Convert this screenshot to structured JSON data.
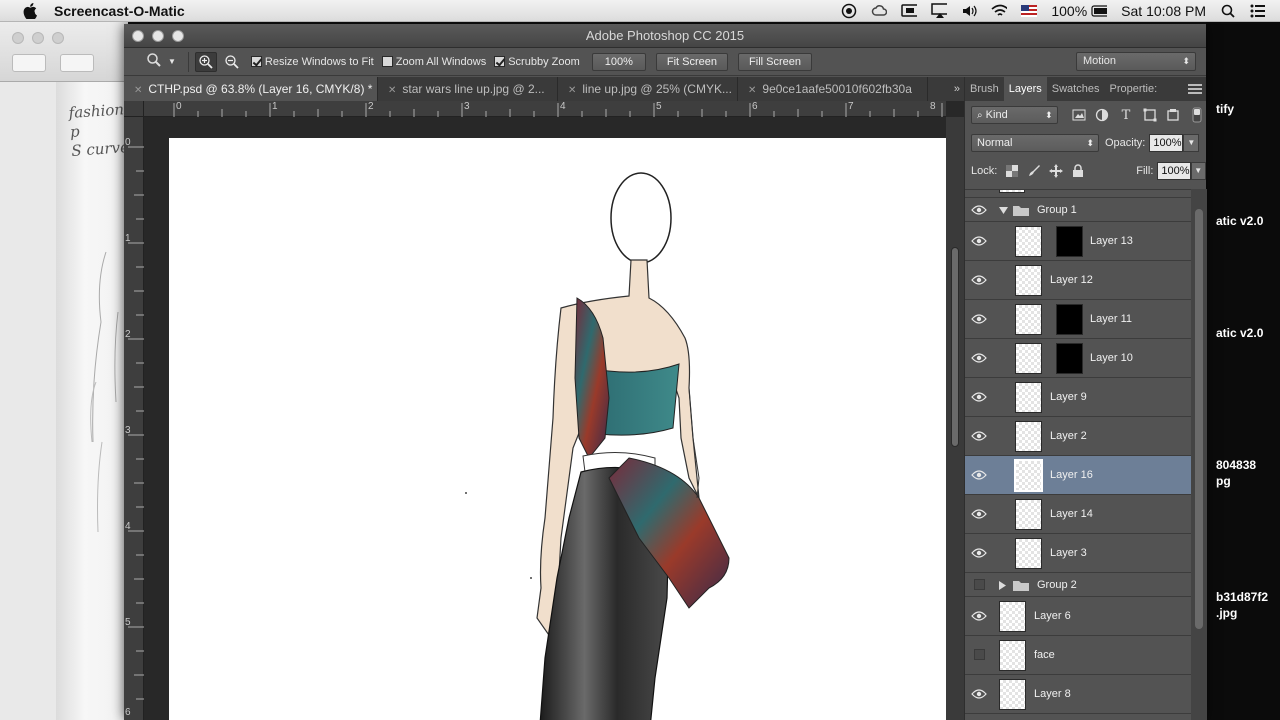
{
  "menubar": {
    "app_name": "Screencast-O-Matic",
    "battery": "100%",
    "clock": "Sat 10:08 PM"
  },
  "background_left": {
    "paper_text_1": "fashion p",
    "paper_text_2": "S curve"
  },
  "background_right": {
    "labels": [
      "tify",
      "atic v2.0",
      "atic v2.0",
      "804838",
      "pg",
      "b31d87f2",
      ".jpg"
    ]
  },
  "window": {
    "title": "Adobe Photoshop CC 2015"
  },
  "options": {
    "resize_windows": "Resize Windows to Fit",
    "zoom_all": "Zoom All Windows",
    "scrubby": "Scrubby Zoom",
    "zoom_value": "100%",
    "fit_screen": "Fit Screen",
    "fill_screen": "Fill Screen",
    "workspace": "Motion"
  },
  "doc_tabs": [
    "CTHP.psd @ 63.8% (Layer 16, CMYK/8) *",
    "star wars line up.jpg @ 2...",
    "line up.jpg @ 25% (CMYK...",
    "9e0ce1aafe50010f602fb30a"
  ],
  "tabs_more": "»",
  "rulers": {
    "h": [
      "0",
      "1",
      "2",
      "3",
      "4",
      "5",
      "6",
      "7",
      "8"
    ],
    "v": [
      "0",
      "1",
      "2",
      "3",
      "4",
      "5",
      "6"
    ]
  },
  "panel_tabs": [
    "Brush",
    "Layers",
    "Swatches",
    "Propertie:"
  ],
  "layers_panel": {
    "filter_kind": "Kind",
    "blend_mode": "Normal",
    "opacity_label": "Opacity:",
    "opacity_value": "100%",
    "lock_label": "Lock:",
    "fill_label": "Fill:",
    "fill_value": "100%"
  },
  "layers": [
    {
      "name": "Group 1",
      "type": "group",
      "expanded": true,
      "visible": true
    },
    {
      "name": "Layer 13",
      "type": "layer",
      "indent": true,
      "mask": true,
      "visible": true
    },
    {
      "name": "Layer 12",
      "type": "layer",
      "indent": true,
      "mask": false,
      "visible": true
    },
    {
      "name": "Layer 11",
      "type": "layer",
      "indent": true,
      "mask": true,
      "visible": true
    },
    {
      "name": "Layer 10",
      "type": "layer",
      "indent": true,
      "mask": true,
      "visible": true
    },
    {
      "name": "Layer 9",
      "type": "layer",
      "indent": true,
      "mask": false,
      "visible": true
    },
    {
      "name": "Layer 2",
      "type": "layer",
      "indent": true,
      "mask": false,
      "visible": true
    },
    {
      "name": "Layer 16",
      "type": "layer",
      "indent": true,
      "mask": false,
      "visible": true,
      "selected": true
    },
    {
      "name": "Layer 14",
      "type": "layer",
      "indent": true,
      "mask": false,
      "visible": true
    },
    {
      "name": "Layer 3",
      "type": "layer",
      "indent": true,
      "mask": false,
      "visible": true
    },
    {
      "name": "Group 2",
      "type": "group",
      "expanded": false,
      "visible": false
    },
    {
      "name": "Layer 6",
      "type": "layer",
      "indent": false,
      "mask": false,
      "visible": true
    },
    {
      "name": "face",
      "type": "layer",
      "indent": false,
      "mask": false,
      "visible": false
    },
    {
      "name": "Layer 8",
      "type": "layer",
      "indent": false,
      "mask": false,
      "visible": true
    }
  ],
  "colors": {
    "selected_layer": "#6d7f97",
    "panel_bg": "#535353",
    "canvas_bg": "#282828"
  }
}
